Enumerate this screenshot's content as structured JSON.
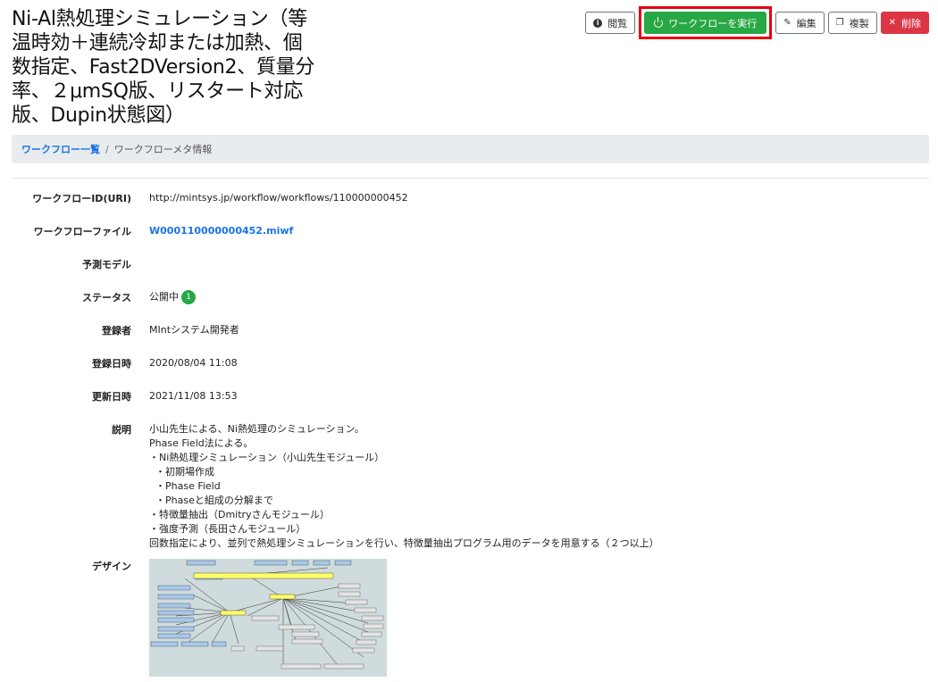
{
  "page": {
    "title_lines": [
      "Ni-Al熱処理シミュレーション（等",
      "温時効＋連続冷却または加熱、個",
      "数指定、Fast2DVersion2、質量分",
      "率、２μmSQ版、リスタート対応",
      "版、Dupin状態図）"
    ]
  },
  "toolbar": {
    "view_label": "閲覧",
    "run_label": "ワークフローを実行",
    "edit_label": "編集",
    "copy_label": "複製",
    "delete_label": "削除"
  },
  "breadcrumb": {
    "list_link": "ワークフロー一覧",
    "separator": "/",
    "current": "ワークフローメタ情報"
  },
  "meta": {
    "id_label": "ワークフローID(URI)",
    "id_value": "http://mintsys.jp/workflow/workflows/110000000452",
    "file_label": "ワークフローファイル",
    "file_value": "W000110000000452.miwf",
    "model_label": "予測モデル",
    "model_value": "",
    "status_label": "ステータス",
    "status_value": "公開中",
    "status_badge": "1",
    "registrant_label": "登録者",
    "registrant_value": "MIntシステム開発者",
    "registered_label": "登録日時",
    "registered_value": "2020/08/04 11:08",
    "updated_label": "更新日時",
    "updated_value": "2021/11/08 13:53",
    "desc_label": "説明",
    "desc_lines": [
      "小山先生による、Ni熱処理のシミュレーション。",
      "Phase Field法による。",
      "・Ni熱処理シミュレーション（小山先生モジュール）",
      "  ・初期場作成",
      "  ・Phase Field",
      "  ・Phaseと組成の分解まで",
      "・特徴量抽出（Dmitryさんモジュール）",
      "・強度予測（長田さんモジュール）",
      "回数指定により、並列で熱処理シミュレーションを行い、特徴量抽出プログラム用のデータを用意する（２つ以上）"
    ],
    "design_label": "デザイン"
  },
  "colors": {
    "primary_link": "#1a73e8",
    "success": "#28a745",
    "danger": "#dc3545",
    "highlight": "#e60012"
  }
}
